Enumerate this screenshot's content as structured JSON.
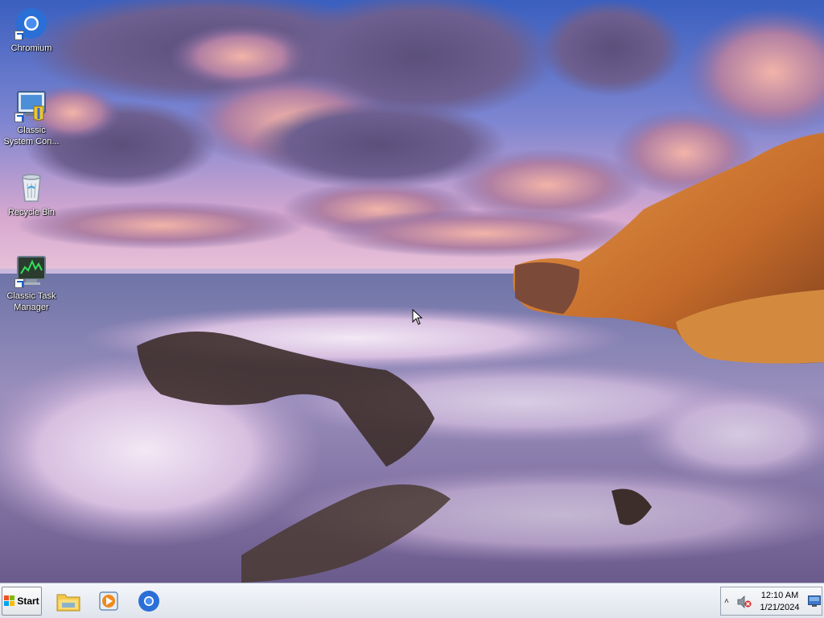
{
  "desktop": {
    "icons": [
      {
        "label": "Chromium",
        "icon": "chromium-icon"
      },
      {
        "label": "Classic\nSystem Con...",
        "icon": "control-panel-icon"
      },
      {
        "label": "Recycle Bin",
        "icon": "recycle-bin-icon"
      },
      {
        "label": "Classic Task\nManager",
        "icon": "task-manager-icon"
      }
    ]
  },
  "taskbar": {
    "start_label": "Start",
    "pinned": [
      {
        "name": "file-explorer",
        "icon": "folder-icon"
      },
      {
        "name": "media-player",
        "icon": "media-player-icon"
      },
      {
        "name": "chromium",
        "icon": "chromium-icon"
      }
    ],
    "tray": {
      "chevron": "˄",
      "time": "12:10 AM",
      "date": "1/21/2024",
      "volume_icon": "volume-muted-icon"
    }
  },
  "colors": {
    "taskbar_bg": "#e6e9ee",
    "chromium_blue": "#2a6fd6",
    "label_text": "#ffffff"
  }
}
